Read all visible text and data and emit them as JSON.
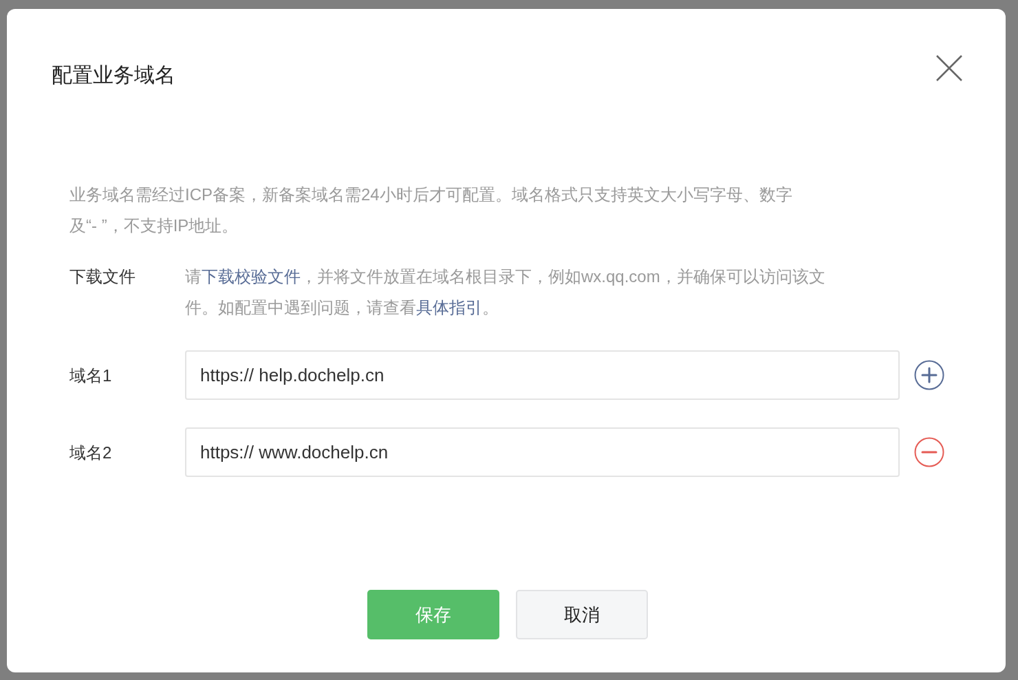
{
  "dialog": {
    "title": "配置业务域名",
    "notice": "业务域名需经过ICP备案，新备案域名需24小时后才可配置。域名格式只支持英文大小写字母、数字及“- ”，不支持IP地址。",
    "download": {
      "label": "下载文件",
      "parts": [
        {
          "kind": "plain",
          "text": "请"
        },
        {
          "kind": "link",
          "text": "下载校验文件"
        },
        {
          "kind": "plain",
          "text": "，并将文件放置在域名根目录下，例如wx.qq.com，并确保可以访问该文件。如配置中遇到问题，请查看"
        },
        {
          "kind": "link",
          "text": "具体指引"
        },
        {
          "kind": "plain",
          "text": "。"
        }
      ]
    },
    "domains": [
      {
        "label": "域名1",
        "value": "https:// help.dochelp.cn",
        "kind": "add"
      },
      {
        "label": "域名2",
        "value": "https:// www.dochelp.cn",
        "kind": "remove"
      }
    ],
    "buttons": [
      {
        "label": "保存",
        "kind": "primary"
      },
      {
        "label": "取消",
        "kind": "secondary"
      }
    ]
  }
}
